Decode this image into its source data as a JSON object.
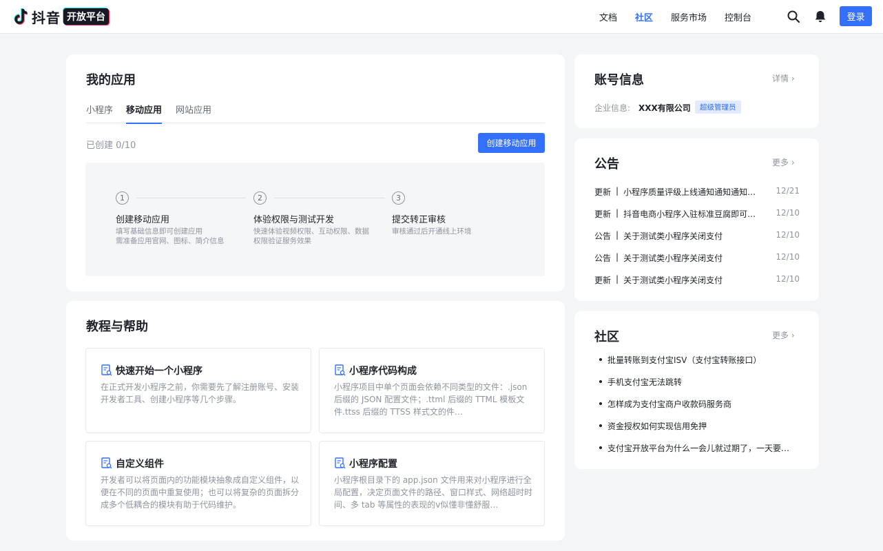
{
  "header": {
    "logo_text": "抖音",
    "logo_badge": "开放平台",
    "nav": [
      {
        "label": "文档",
        "active": false
      },
      {
        "label": "社区",
        "active": true
      },
      {
        "label": "服务市场",
        "active": false
      },
      {
        "label": "控制台",
        "active": false
      }
    ],
    "login_label": "登录",
    "icons": [
      "search-icon",
      "bell-icon"
    ]
  },
  "my_apps": {
    "title": "我的应用",
    "tabs": [
      "小程序",
      "移动应用",
      "网站应用"
    ],
    "active_tab": "移动应用",
    "created_text": "已创建 0/10",
    "create_button": "创建移动应用",
    "steps": [
      {
        "num": "1",
        "title": "创建移动应用",
        "desc_lines": [
          "填写基础信息即可创建应用",
          "需准备应用官网、图标、简介信息"
        ]
      },
      {
        "num": "2",
        "title": "体验权限与测试开发",
        "desc_lines": [
          "快速体验视频权限、互动权限、数据",
          "权限验证服务效果"
        ]
      },
      {
        "num": "3",
        "title": "提交转正审核",
        "desc_lines": [
          "审核通过后开通线上环境"
        ]
      }
    ]
  },
  "tutorials": {
    "title": "教程与帮助",
    "items": [
      {
        "title": "快速开始一个小程序",
        "desc": "在正式开发小程序之前，你需要先了解注册账号、安装开发者工具、创建小程序等几个步骤。"
      },
      {
        "title": "小程序代码构成",
        "desc": "小程序项目中单个页面会依赖不同类型的文件：.json 后缀的 JSON 配置文件；.ttml 后缀的 TTML 模板文件.ttss 后缀的 TTSS 样式文的件…"
      },
      {
        "title": "自定义组件",
        "desc": "开发者可以将页面内的功能模块抽象成自定义组件，以便在不同的页面中重复使用；也可以将复杂的页面拆分成多个低耦合的模块有助于代码维护。"
      },
      {
        "title": "小程序配置",
        "desc": "小程序根目录下的 app.json 文件用来对小程序进行全局配置，决定页面文件的路径、窗口样式、网络超时时间、多 tab 等属性的表现的v似懂非懂舒服…"
      }
    ]
  },
  "account": {
    "title": "账号信息",
    "detail_link": "详情",
    "company_label": "企业信息:",
    "company_name": "XXX有限公司",
    "role_badge": "超级管理员"
  },
  "announcements": {
    "title": "公告",
    "more_link": "更多",
    "items": [
      {
        "tag": "更新",
        "text": "小程序质量评级上线通知通知通知…",
        "date": "12/21"
      },
      {
        "tag": "更新",
        "text": "抖音电商小程序入驻标准豆腐即可…",
        "date": "12/10"
      },
      {
        "tag": "公告",
        "text": "关于测试类小程序关闭支付",
        "date": "12/10"
      },
      {
        "tag": "公告",
        "text": "关于测试类小程序关闭支付",
        "date": "12/10"
      },
      {
        "tag": "更新",
        "text": "关于测试类小程序关闭支付",
        "date": "12/10"
      }
    ]
  },
  "community": {
    "title": "社区",
    "more_link": "更多",
    "items": [
      "批量转账到支付宝ISV（支付宝转账接口）",
      "手机支付宝无法跳转",
      "怎样成为支付宝商户收款码服务商",
      "资金授权如何实现信用免押",
      "支付宝开放平台为什么一会儿就过期了，一天要…"
    ]
  },
  "colors": {
    "accent": "#3370ff",
    "brand_red": "#fe2c55",
    "brand_cyan": "#25f4ee"
  }
}
